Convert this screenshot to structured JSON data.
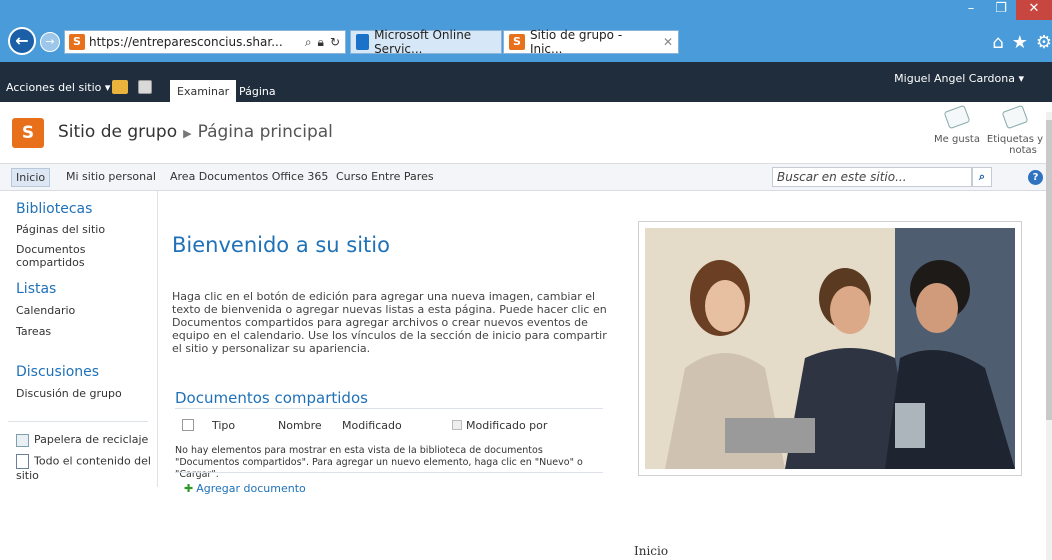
{
  "browser": {
    "url": "https://entreparesconcius.shar...",
    "tabs": [
      {
        "label": "Microsoft Online Servic..."
      },
      {
        "label": "Sitio de grupo - Inic..."
      }
    ]
  },
  "ribbon": {
    "site_actions": "Acciones del sitio",
    "tabs": [
      "Examinar",
      "Página"
    ],
    "user": "Miguel Angel Cardona"
  },
  "title": {
    "site": "Sitio de grupo",
    "page": "Página principal",
    "like": "Me gusta",
    "tags_line1": "Etiquetas y",
    "tags_line2": "notas"
  },
  "topnav": {
    "items": [
      "Inicio",
      "Mi sitio personal",
      "Area Documentos Office 365",
      "Curso Entre Pares"
    ],
    "search_placeholder": "Buscar en este sitio..."
  },
  "leftnav": {
    "sections": [
      {
        "title": "Bibliotecas",
        "links": [
          "Páginas del sitio",
          "Documentos compartidos"
        ]
      },
      {
        "title": "Listas",
        "links": [
          "Calendario",
          "Tareas"
        ]
      },
      {
        "title": "Discusiones",
        "links": [
          "Discusión de grupo"
        ]
      }
    ],
    "recycle": "Papelera de reciclaje",
    "all_content_1": "Todo el contenido del",
    "all_content_2": "sitio"
  },
  "main": {
    "welcome": "Bienvenido a su sitio",
    "intro": "Haga clic en el botón de edición para agregar una nueva imagen, cambiar el texto de bienvenida o agregar nuevas listas a esta página. Puede hacer clic en Documentos compartidos para agregar archivos o crear nuevos eventos de equipo en el calendario. Use los vínculos de la sección de inicio para compartir el sitio y personalizar su apariencia.",
    "docs_title": "Documentos compartidos",
    "columns": [
      "Tipo",
      "Nombre",
      "Modificado",
      "Modificado por"
    ],
    "empty": "No hay elementos para mostrar en esta vista de la biblioteca de documentos \"Documentos compartidos\". Para agregar un nuevo elemento, haga clic en \"Nuevo\" o \"Cargar\".",
    "add_doc": "Agregar documento"
  },
  "caption": "Inicio"
}
